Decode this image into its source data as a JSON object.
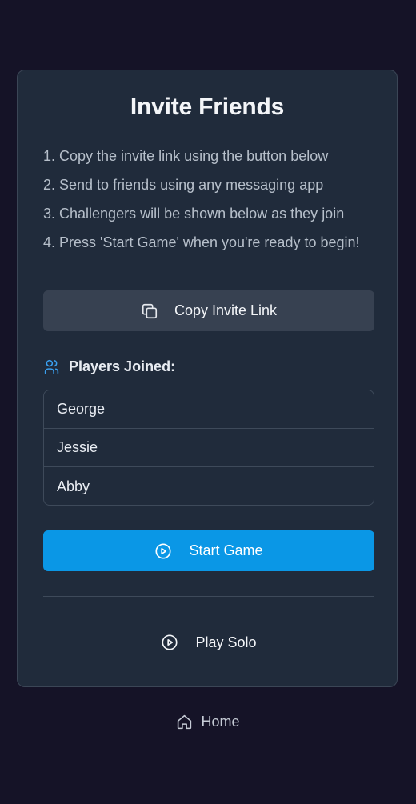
{
  "card": {
    "title": "Invite Friends",
    "steps": [
      "1. Copy the invite link using the button below",
      "2. Send to friends using any messaging app",
      "3. Challengers will be shown below as they join",
      "4. Press 'Start Game' when you're ready to begin!"
    ],
    "copy_button": {
      "label": "Copy Invite Link",
      "icon": "copy-icon"
    },
    "players": {
      "header": "Players Joined:",
      "icon": "users-icon",
      "list": [
        "George",
        "Jessie",
        "Abby"
      ]
    },
    "start_button": {
      "label": "Start Game",
      "icon": "play-circle-icon"
    },
    "solo_button": {
      "label": "Play Solo",
      "icon": "play-circle-icon"
    }
  },
  "footer": {
    "home_label": "Home",
    "home_icon": "home-icon"
  },
  "colors": {
    "background": "#151327",
    "card": "#202b3b",
    "accent": "#0a97e6",
    "secondary_button": "#374151"
  }
}
